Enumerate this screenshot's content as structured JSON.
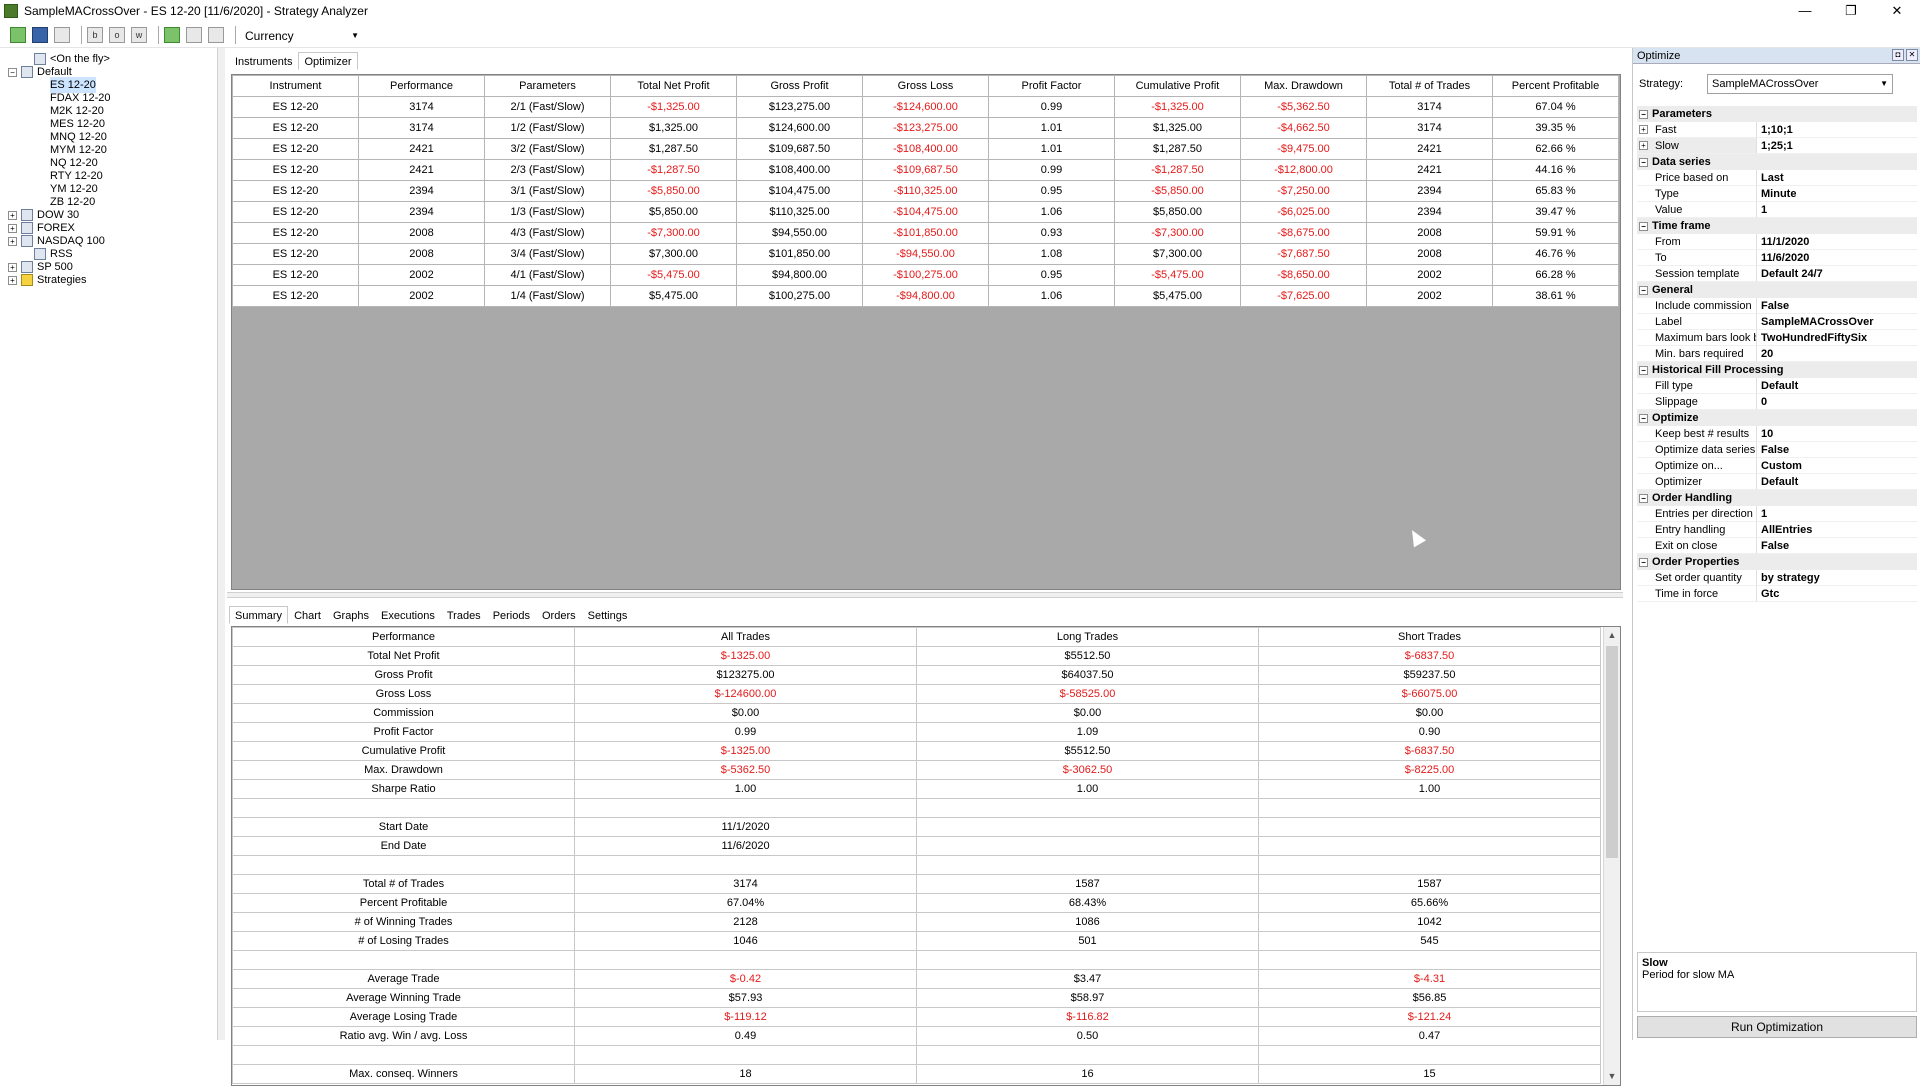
{
  "window": {
    "title": "SampleMACrossOver - ES 12-20 [11/6/2020] - Strategy Analyzer",
    "controls": [
      "—",
      "❐",
      "✕"
    ]
  },
  "toolbar": {
    "currency_label": "Currency",
    "buttons": [
      "open-icon",
      "save-icon",
      "print-icon",
      "b",
      "o",
      "w",
      "add-icon",
      "edit-icon",
      "remove-icon"
    ]
  },
  "tree": {
    "items": [
      {
        "label": "<On the fly>",
        "level": 1,
        "expander": "",
        "icon": "list"
      },
      {
        "label": "Default",
        "level": 0,
        "expander": "⊟",
        "icon": "list"
      },
      {
        "label": "ES 12-20",
        "level": 2,
        "expander": "",
        "icon": "",
        "selected": true
      },
      {
        "label": "FDAX 12-20",
        "level": 2,
        "expander": "",
        "icon": ""
      },
      {
        "label": "M2K 12-20",
        "level": 2,
        "expander": "",
        "icon": ""
      },
      {
        "label": "MES 12-20",
        "level": 2,
        "expander": "",
        "icon": ""
      },
      {
        "label": "MNQ 12-20",
        "level": 2,
        "expander": "",
        "icon": ""
      },
      {
        "label": "MYM 12-20",
        "level": 2,
        "expander": "",
        "icon": ""
      },
      {
        "label": "NQ 12-20",
        "level": 2,
        "expander": "",
        "icon": ""
      },
      {
        "label": "RTY 12-20",
        "level": 2,
        "expander": "",
        "icon": ""
      },
      {
        "label": "YM 12-20",
        "level": 2,
        "expander": "",
        "icon": ""
      },
      {
        "label": "ZB 12-20",
        "level": 2,
        "expander": "",
        "icon": ""
      },
      {
        "label": "DOW 30",
        "level": 0,
        "expander": "⊞",
        "icon": "list"
      },
      {
        "label": "FOREX",
        "level": 0,
        "expander": "⊞",
        "icon": "list"
      },
      {
        "label": "NASDAQ 100",
        "level": 0,
        "expander": "⊞",
        "icon": "list"
      },
      {
        "label": "RSS",
        "level": 1,
        "expander": "",
        "icon": "list"
      },
      {
        "label": "SP 500",
        "level": 0,
        "expander": "⊞",
        "icon": "list"
      },
      {
        "label": "Strategies",
        "level": 0,
        "expander": "⊞",
        "icon": "strategy"
      }
    ]
  },
  "top_tabs": [
    "Instruments",
    "Optimizer"
  ],
  "optimizer": {
    "columns": [
      "Instrument",
      "Performance",
      "Parameters",
      "Total Net Profit",
      "Gross Profit",
      "Gross Loss",
      "Profit Factor",
      "Cumulative Profit",
      "Max. Drawdown",
      "Total # of Trades",
      "Percent Profitable"
    ],
    "rows": [
      [
        "ES 12-20",
        "3174",
        "2/1 (Fast/Slow)",
        "-$1,325.00",
        "$123,275.00",
        "-$124,600.00",
        "0.99",
        "-$1,325.00",
        "-$5,362.50",
        "3174",
        "67.04 %"
      ],
      [
        "ES 12-20",
        "3174",
        "1/2 (Fast/Slow)",
        "$1,325.00",
        "$124,600.00",
        "-$123,275.00",
        "1.01",
        "$1,325.00",
        "-$4,662.50",
        "3174",
        "39.35 %"
      ],
      [
        "ES 12-20",
        "2421",
        "3/2 (Fast/Slow)",
        "$1,287.50",
        "$109,687.50",
        "-$108,400.00",
        "1.01",
        "$1,287.50",
        "-$9,475.00",
        "2421",
        "62.66 %"
      ],
      [
        "ES 12-20",
        "2421",
        "2/3 (Fast/Slow)",
        "-$1,287.50",
        "$108,400.00",
        "-$109,687.50",
        "0.99",
        "-$1,287.50",
        "-$12,800.00",
        "2421",
        "44.16 %"
      ],
      [
        "ES 12-20",
        "2394",
        "3/1 (Fast/Slow)",
        "-$5,850.00",
        "$104,475.00",
        "-$110,325.00",
        "0.95",
        "-$5,850.00",
        "-$7,250.00",
        "2394",
        "65.83 %"
      ],
      [
        "ES 12-20",
        "2394",
        "1/3 (Fast/Slow)",
        "$5,850.00",
        "$110,325.00",
        "-$104,475.00",
        "1.06",
        "$5,850.00",
        "-$6,025.00",
        "2394",
        "39.47 %"
      ],
      [
        "ES 12-20",
        "2008",
        "4/3 (Fast/Slow)",
        "-$7,300.00",
        "$94,550.00",
        "-$101,850.00",
        "0.93",
        "-$7,300.00",
        "-$8,675.00",
        "2008",
        "59.91 %"
      ],
      [
        "ES 12-20",
        "2008",
        "3/4 (Fast/Slow)",
        "$7,300.00",
        "$101,850.00",
        "-$94,550.00",
        "1.08",
        "$7,300.00",
        "-$7,687.50",
        "2008",
        "46.76 %"
      ],
      [
        "ES 12-20",
        "2002",
        "4/1 (Fast/Slow)",
        "-$5,475.00",
        "$94,800.00",
        "-$100,275.00",
        "0.95",
        "-$5,475.00",
        "-$8,650.00",
        "2002",
        "66.28 %"
      ],
      [
        "ES 12-20",
        "2002",
        "1/4 (Fast/Slow)",
        "$5,475.00",
        "$100,275.00",
        "-$94,800.00",
        "1.06",
        "$5,475.00",
        "-$7,625.00",
        "2002",
        "38.61 %"
      ]
    ]
  },
  "bottom_tabs": [
    "Summary",
    "Chart",
    "Graphs",
    "Executions",
    "Trades",
    "Periods",
    "Orders",
    "Settings"
  ],
  "summary": {
    "columns": [
      "Performance",
      "All Trades",
      "Long Trades",
      "Short Trades"
    ],
    "rows": [
      [
        "Total Net Profit",
        "$-1325.00",
        "$5512.50",
        "$-6837.50"
      ],
      [
        "Gross Profit",
        "$123275.00",
        "$64037.50",
        "$59237.50"
      ],
      [
        "Gross Loss",
        "$-124600.00",
        "$-58525.00",
        "$-66075.00"
      ],
      [
        "Commission",
        "$0.00",
        "$0.00",
        "$0.00"
      ],
      [
        "Profit Factor",
        "0.99",
        "1.09",
        "0.90"
      ],
      [
        "Cumulative Profit",
        "$-1325.00",
        "$5512.50",
        "$-6837.50"
      ],
      [
        "Max. Drawdown",
        "$-5362.50",
        "$-3062.50",
        "$-8225.00"
      ],
      [
        "Sharpe Ratio",
        "1.00",
        "1.00",
        "1.00"
      ],
      [
        "",
        "",
        "",
        ""
      ],
      [
        "Start Date",
        "11/1/2020",
        "",
        ""
      ],
      [
        "End Date",
        "11/6/2020",
        "",
        ""
      ],
      [
        "",
        "",
        "",
        ""
      ],
      [
        "Total # of Trades",
        "3174",
        "1587",
        "1587"
      ],
      [
        "Percent Profitable",
        "67.04%",
        "68.43%",
        "65.66%"
      ],
      [
        "# of Winning Trades",
        "2128",
        "1086",
        "1042"
      ],
      [
        "# of Losing Trades",
        "1046",
        "501",
        "545"
      ],
      [
        "",
        "",
        "",
        ""
      ],
      [
        "Average Trade",
        "$-0.42",
        "$3.47",
        "$-4.31"
      ],
      [
        "Average Winning Trade",
        "$57.93",
        "$58.97",
        "$56.85"
      ],
      [
        "Average Losing Trade",
        "$-119.12",
        "$-116.82",
        "$-121.24"
      ],
      [
        "Ratio avg. Win / avg. Loss",
        "0.49",
        "0.50",
        "0.47"
      ],
      [
        "",
        "",
        "",
        ""
      ],
      [
        "Max. conseq. Winners",
        "18",
        "16",
        "15"
      ]
    ]
  },
  "optimize_panel": {
    "title": "Optimize",
    "strategy_label": "Strategy:",
    "strategy_value": "SampleMACrossOver",
    "sections": [
      {
        "name": "Parameters",
        "props": [
          {
            "k": "Fast",
            "v": "1;10;1",
            "expander": "⊞"
          },
          {
            "k": "Slow",
            "v": "1;25;1",
            "expander": "⊞",
            "selected": true
          }
        ]
      },
      {
        "name": "Data series",
        "props": [
          {
            "k": "Price based on",
            "v": "Last"
          },
          {
            "k": "Type",
            "v": "Minute"
          },
          {
            "k": "Value",
            "v": "1"
          }
        ]
      },
      {
        "name": "Time frame",
        "props": [
          {
            "k": "From",
            "v": "11/1/2020"
          },
          {
            "k": "To",
            "v": "11/6/2020"
          },
          {
            "k": "Session template",
            "v": "Default 24/7"
          }
        ]
      },
      {
        "name": "General",
        "props": [
          {
            "k": "Include commission",
            "v": "False"
          },
          {
            "k": "Label",
            "v": "SampleMACrossOver"
          },
          {
            "k": "Maximum bars look bac",
            "v": "TwoHundredFiftySix"
          },
          {
            "k": "Min. bars required",
            "v": "20"
          }
        ]
      },
      {
        "name": "Historical Fill Processing",
        "props": [
          {
            "k": "Fill type",
            "v": "Default"
          },
          {
            "k": "Slippage",
            "v": "0"
          }
        ]
      },
      {
        "name": "Optimize",
        "props": [
          {
            "k": "Keep best # results",
            "v": "10"
          },
          {
            "k": "Optimize data series",
            "v": "False"
          },
          {
            "k": "Optimize on...",
            "v": "Custom"
          },
          {
            "k": "Optimizer",
            "v": "Default"
          }
        ]
      },
      {
        "name": "Order Handling",
        "props": [
          {
            "k": "Entries per direction",
            "v": "1"
          },
          {
            "k": "Entry handling",
            "v": "AllEntries"
          },
          {
            "k": "Exit on close",
            "v": "False"
          }
        ]
      },
      {
        "name": "Order Properties",
        "props": [
          {
            "k": "Set order quantity",
            "v": "by strategy"
          },
          {
            "k": "Time in force",
            "v": "Gtc"
          }
        ]
      }
    ],
    "help_title": "Slow",
    "help_text": "Period for slow MA",
    "run_label": "Run Optimization"
  },
  "colors": {
    "negative": "#e41a1a",
    "selection": "#cce4ff",
    "grid_bg": "#a9a9a9"
  }
}
